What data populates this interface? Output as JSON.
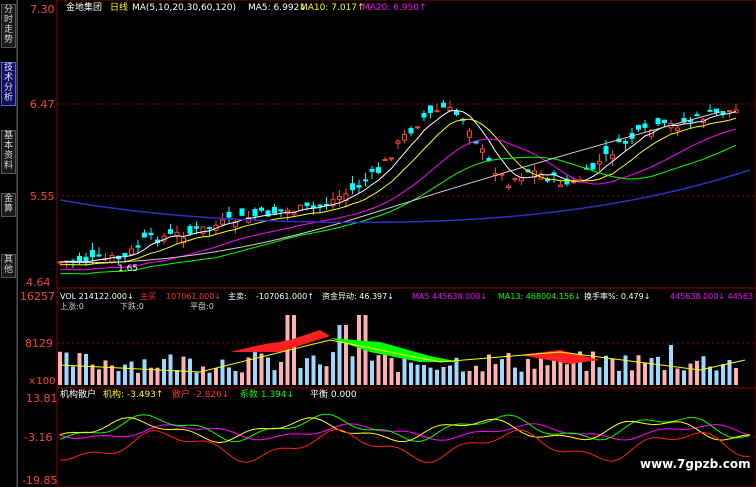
{
  "sidebar": {
    "tabs": [
      {
        "label": "分时走势",
        "active": false
      },
      {
        "label": "技术分析",
        "active": true
      },
      {
        "label": "基本资料",
        "active": false
      },
      {
        "label": "金算",
        "active": false
      },
      {
        "label": "其他",
        "active": false
      }
    ]
  },
  "main": {
    "stock_name": "金地集团",
    "period": "日线",
    "ma_params": "MA(5,10,20,30,60,120)",
    "ma5": "MA5: 6.992↓",
    "ma10": "MA10: 7.017↑",
    "ma20": "MA20: 6.950↑",
    "y_ticks": [
      "7.30",
      "6.47",
      "5.55",
      "4.64"
    ],
    "low_marker": "1.65"
  },
  "volume": {
    "line1": "VOL 214122.000↓",
    "net_label": "主买",
    "net_value": "107061.000↓",
    "main_label": "主卖:",
    "main_value": "-107061.000↑",
    "flow": "资金异动: 46.397↓",
    "ma5": "MA5 445638.000↓",
    "ma13": "MA13: 468004.156↓",
    "turnover": "换手率%: 0.479↓",
    "right_value": "445638.000↓ 44563",
    "sub_labels": [
      "上涨:0",
      "下跌:0",
      "平盘:0"
    ],
    "y_ticks": [
      "16257",
      "8129",
      "×100"
    ]
  },
  "indicator": {
    "label": "机构散户",
    "inst": "机构: -3.493↑",
    "retail": "散户 -2.826↓",
    "coef": "系数 1.394↓",
    "balance": "平衡 0.000",
    "y_ticks": [
      "13.81",
      "-3.16",
      "-19.85"
    ]
  },
  "watermark": "www.7gpzb.com",
  "colors": {
    "up": "#ff4040",
    "down": "#00ffff",
    "grid": "#8b0000",
    "ma5": "#ffffff",
    "ma10": "#ffff00",
    "ma20": "#ff00ff",
    "ma30": "#00ff00",
    "ma60": "#3030c0"
  }
}
